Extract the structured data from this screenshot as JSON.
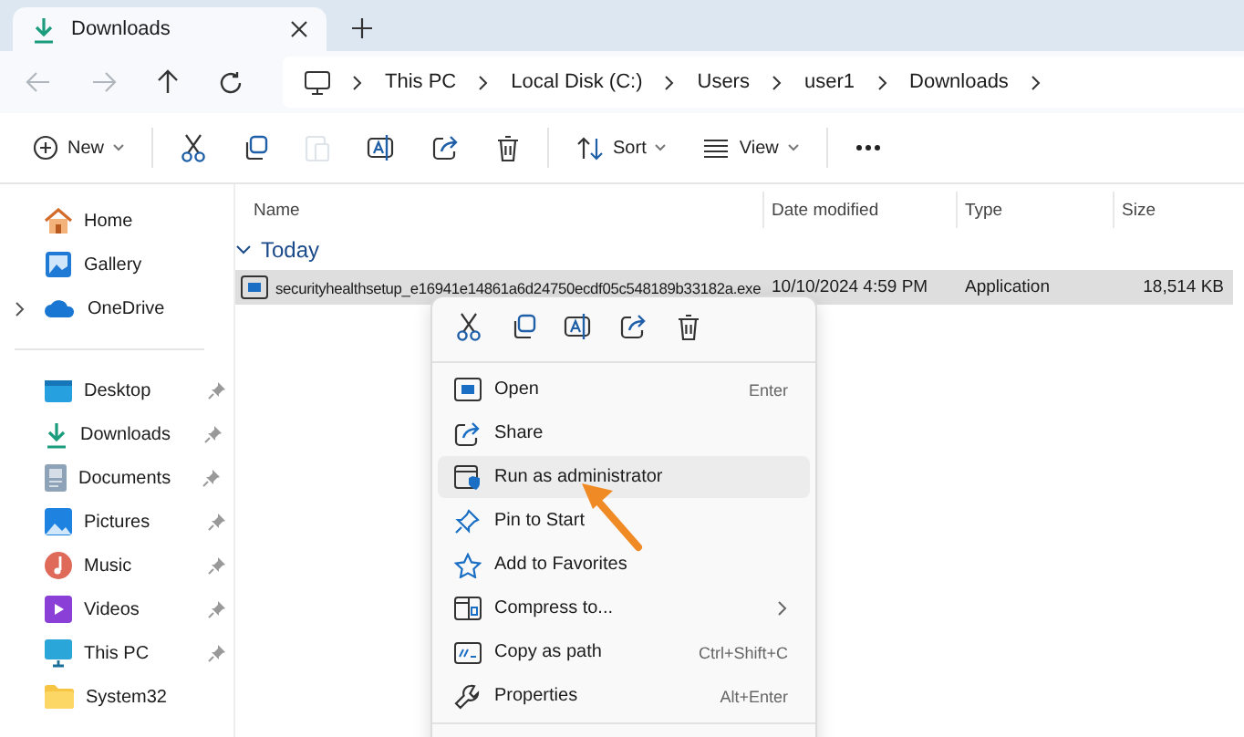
{
  "tab": {
    "title": "Downloads",
    "selected": true
  },
  "nav": {
    "back_disabled": true,
    "forward_disabled": true
  },
  "breadcrumbs": [
    "This PC",
    "Local Disk (C:)",
    "Users",
    "user1",
    "Downloads"
  ],
  "toolbar": [
    {
      "kind": "new",
      "label": "New",
      "disabled": false
    },
    {
      "kind": "cut",
      "disabled": false
    },
    {
      "kind": "copy",
      "disabled": false
    },
    {
      "kind": "paste",
      "disabled": true
    },
    {
      "kind": "rename",
      "disabled": false
    },
    {
      "kind": "share",
      "disabled": false
    },
    {
      "kind": "delete",
      "disabled": false
    },
    {
      "kind": "sort",
      "label": "Sort",
      "disabled": false
    },
    {
      "kind": "view",
      "label": "View",
      "disabled": false
    },
    {
      "kind": "more",
      "disabled": false
    }
  ],
  "sidebar": {
    "top": [
      {
        "kind": "home",
        "label": "Home",
        "expandable": false
      },
      {
        "kind": "gallery",
        "label": "Gallery",
        "expandable": false
      },
      {
        "kind": "cloud",
        "label": "OneDrive",
        "expandable": true
      }
    ],
    "quick": [
      {
        "kind": "desktop",
        "label": "Desktop",
        "pinned": true
      },
      {
        "kind": "downloads",
        "label": "Downloads",
        "pinned": true
      },
      {
        "kind": "documents",
        "label": "Documents",
        "pinned": true
      },
      {
        "kind": "pictures",
        "label": "Pictures",
        "pinned": true
      },
      {
        "kind": "music",
        "label": "Music",
        "pinned": true
      },
      {
        "kind": "videos",
        "label": "Videos",
        "pinned": true
      },
      {
        "kind": "pc",
        "label": "This PC",
        "pinned": true
      },
      {
        "kind": "folder",
        "label": "System32",
        "pinned": false
      }
    ]
  },
  "table": {
    "columns": [
      "Name",
      "Date modified",
      "Type",
      "Size"
    ],
    "group": "Today",
    "rows": [
      {
        "name": "securityhealthsetup_e16941e14861a6d24750ecdf05c548189b33182a.exe",
        "date": "10/10/2024 4:59 PM",
        "type": "Application",
        "size": "18,514 KB",
        "selected": true
      }
    ]
  },
  "context_menu": {
    "quick_actions": [
      {
        "kind": "cut"
      },
      {
        "kind": "copy"
      },
      {
        "kind": "rename"
      },
      {
        "kind": "share"
      },
      {
        "kind": "delete"
      }
    ],
    "items": [
      {
        "kind": "open",
        "label": "Open",
        "shortcut": "Enter",
        "highlighted": false,
        "submenu": false
      },
      {
        "kind": "share",
        "label": "Share",
        "highlighted": false,
        "submenu": false
      },
      {
        "kind": "admin",
        "label": "Run as administrator",
        "highlighted": true,
        "submenu": false
      },
      {
        "kind": "pin",
        "label": "Pin to Start",
        "highlighted": false,
        "submenu": false
      },
      {
        "kind": "star",
        "label": "Add to Favorites",
        "highlighted": false,
        "submenu": false
      },
      {
        "kind": "zip",
        "label": "Compress to...",
        "highlighted": false,
        "submenu": true
      },
      {
        "kind": "path",
        "label": "Copy as path",
        "shortcut": "Ctrl+Shift+C",
        "highlighted": false,
        "submenu": false
      },
      {
        "kind": "wrench",
        "label": "Properties",
        "shortcut": "Alt+Enter",
        "highlighted": false,
        "submenu": false
      }
    ]
  },
  "annotation": {
    "kind": "arrow"
  }
}
